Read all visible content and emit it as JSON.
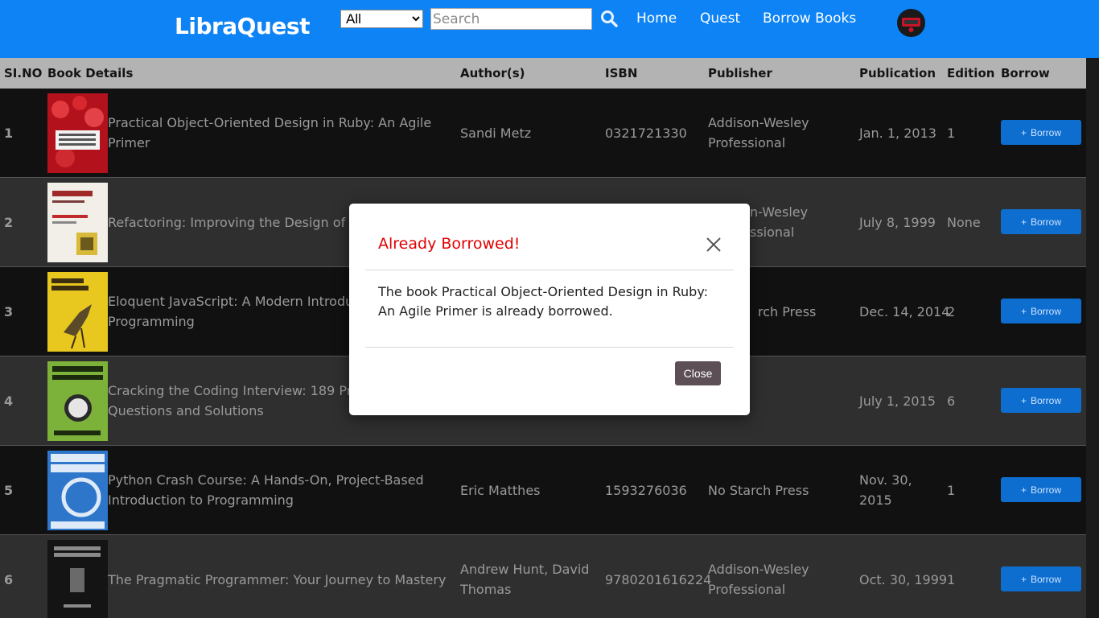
{
  "header": {
    "brand": "LibraQuest",
    "filter_selected": "All",
    "search_placeholder": "Search",
    "nav": [
      "Home",
      "Quest",
      "Borrow Books"
    ]
  },
  "table": {
    "headers": [
      "SI.NO",
      "Book Details",
      "Author(s)",
      "ISBN",
      "Publisher",
      "Publication",
      "Edition",
      "Borrow"
    ],
    "borrow_label": "Borrow",
    "rows": [
      {
        "sn": "1",
        "title": "Practical Object-Oriented Design in Ruby: An Agile Primer",
        "author": "Sandi Metz",
        "isbn": "0321721330",
        "publisher": "Addison-Wesley Professional",
        "publication": "Jan. 1, 2013",
        "edition": "1"
      },
      {
        "sn": "2",
        "title": "Refactoring: Improving the Design of E",
        "author": "",
        "isbn": "",
        "publisher": "n-Wesley\nssional",
        "publication": "July 8, 1999",
        "edition": "None"
      },
      {
        "sn": "3",
        "title": "Eloquent JavaScript: A Modern Introdu\nProgramming",
        "author": "",
        "isbn": "",
        "publisher": "rch Press",
        "publication": "Dec. 14, 2014",
        "edition": "2"
      },
      {
        "sn": "4",
        "title": "Cracking the Coding Interview: 189 Pro\nQuestions and Solutions",
        "author": "",
        "isbn": "",
        "publisher": "",
        "publication": "July 1, 2015",
        "edition": "6"
      },
      {
        "sn": "5",
        "title": "Python Crash Course: A Hands-On, Project-Based Introduction to Programming",
        "author": "Eric Matthes",
        "isbn": "1593276036",
        "publisher": "No Starch Press",
        "publication": "Nov. 30, 2015",
        "edition": "1"
      },
      {
        "sn": "6",
        "title": "The Pragmatic Programmer: Your Journey to Mastery",
        "author": "Andrew Hunt, David Thomas",
        "isbn": "9780201616224",
        "publisher": "Addison-Wesley Professional",
        "publication": "Oct. 30, 1999",
        "edition": "1"
      }
    ]
  },
  "modal": {
    "title": "Already Borrowed!",
    "body": "The book Practical Object-Oriented Design in Ruby: An Agile Primer is already borrowed.",
    "close_label": "Close"
  },
  "colors": {
    "header_bg": "#0d83f5",
    "modal_title": "#e00000",
    "borrow_btn": "#0d6ecf"
  }
}
